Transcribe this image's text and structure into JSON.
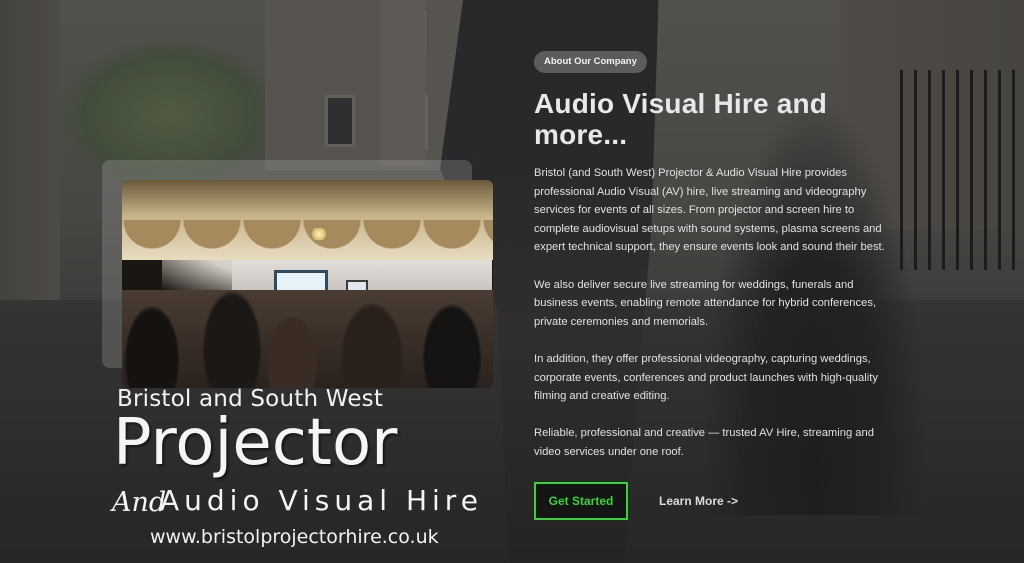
{
  "logo": {
    "line1": "Bristol and South West",
    "main": "Projector",
    "and": "And",
    "av": "Audio Visual Hire",
    "url": "www.bristolprojectorhire.co.uk"
  },
  "about": {
    "badge": "About Our Company",
    "heading": "Audio Visual Hire and more...",
    "paragraphs": [
      "Bristol (and South West) Projector & Audio Visual Hire provides professional Audio Visual (AV) hire, live streaming and videography services for events of all sizes. From projector and screen hire to complete audiovisual setups with sound systems, plasma screens and expert technical support, they ensure events look and sound their best.",
      "We also deliver secure live streaming for weddings, funerals and business events, enabling remote attendance for hybrid conferences, private ceremonies and memorials.",
      "In addition, they offer professional videography, capturing weddings, corporate events, conferences and product launches with high-quality filming and creative editing.",
      "Reliable, professional and creative — trusted AV Hire, streaming and video services under one roof."
    ]
  },
  "actions": {
    "primary_label": "Get Started",
    "secondary_label": "Learn More ->"
  },
  "colors": {
    "accent": "#39d23a",
    "badge_bg": "#5c5c5c",
    "button_bg": "#151515"
  }
}
